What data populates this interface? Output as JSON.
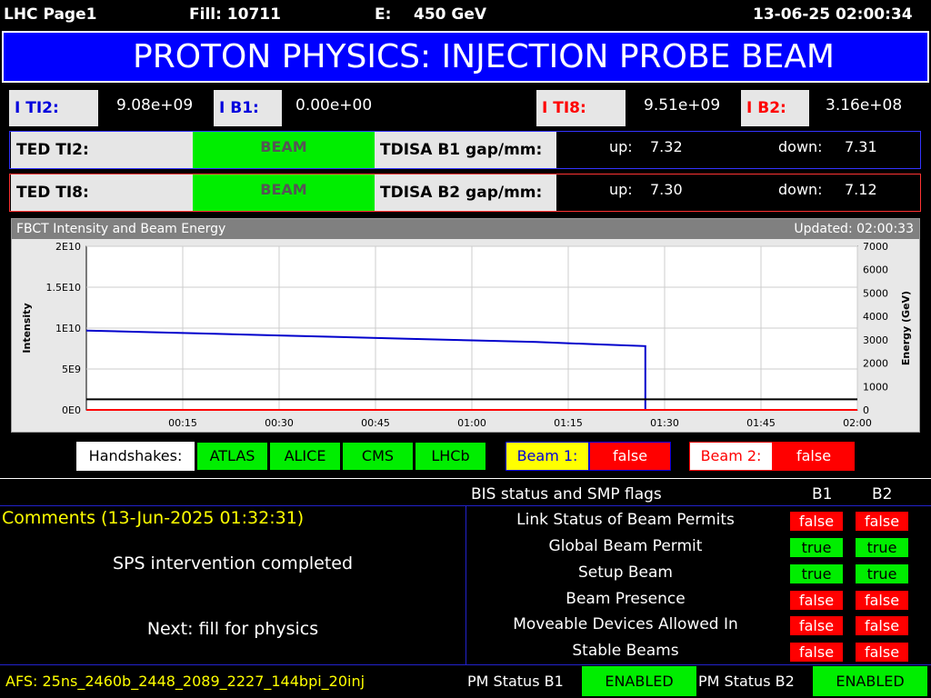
{
  "header": {
    "page": "LHC Page1",
    "fill": "Fill: 10711",
    "energy_label": "E:",
    "energy": "450 GeV",
    "datetime": "13-06-25 02:00:34"
  },
  "banner": {
    "title": "PROTON PHYSICS: INJECTION PROBE BEAM"
  },
  "intensities": {
    "i_ti2": {
      "label": "I TI2:",
      "value": "9.08e+09"
    },
    "i_b1": {
      "label": "I B1:",
      "value": "0.00e+00"
    },
    "i_ti8": {
      "label": "I TI8:",
      "value": "9.51e+09"
    },
    "i_b2": {
      "label": "I B2:",
      "value": "3.16e+08"
    }
  },
  "ted": {
    "ti2": {
      "label": "TED TI2:",
      "state": "BEAM"
    },
    "ti8": {
      "label": "TED TI8:",
      "state": "BEAM"
    }
  },
  "tdisa": {
    "b1": {
      "label": "TDISA B1 gap/mm:",
      "up_label": "up:",
      "up": "7.32",
      "down_label": "down:",
      "down": "7.31"
    },
    "b2": {
      "label": "TDISA B2 gap/mm:",
      "up_label": "up:",
      "up": "7.30",
      "down_label": "down:",
      "down": "7.12"
    }
  },
  "chart": {
    "title": "FBCT Intensity and Beam Energy",
    "updated": "Updated: 02:00:33",
    "ylabel_left": "Intensity",
    "ylabel_right": "Energy (GeV)",
    "left_ticks": [
      "2E10",
      "1.5E10",
      "1E10",
      "5E9",
      "0E0"
    ],
    "right_ticks": [
      "7000",
      "6000",
      "5000",
      "4000",
      "3000",
      "2000",
      "1000",
      "0"
    ],
    "x_ticks": [
      "00:15",
      "00:30",
      "00:45",
      "01:00",
      "01:15",
      "01:30",
      "01:45",
      "02:00"
    ]
  },
  "chart_data": {
    "type": "line",
    "title": "FBCT Intensity and Beam Energy",
    "xlabel": "",
    "ylabel": "Intensity",
    "y2label": "Energy (GeV)",
    "xlim": [
      "00:00",
      "02:00"
    ],
    "ylim": [
      0,
      20000000000
    ],
    "y2lim": [
      0,
      7000
    ],
    "series": [
      {
        "axis": "left",
        "color": "#0000cc",
        "x": [
          "00:00",
          "00:10",
          "00:20",
          "00:30",
          "00:40",
          "00:50",
          "01:00",
          "01:10",
          "01:20",
          "01:27",
          "01:27"
        ],
        "values": [
          9700000000.0,
          9500000000.0,
          9300000000.0,
          9100000000.0,
          8900000000.0,
          8700000000.0,
          8500000000.0,
          8300000000.0,
          8000000000.0,
          7800000000.0,
          0
        ]
      },
      {
        "axis": "right",
        "color": "#000000",
        "x": [
          "00:00",
          "02:00"
        ],
        "values": [
          450,
          450
        ]
      },
      {
        "axis": "left",
        "color": "#ff0000",
        "x": [
          "00:00",
          "02:00"
        ],
        "values": [
          0,
          0
        ]
      }
    ]
  },
  "handshakes": {
    "label": "Handshakes:",
    "items": [
      "ATLAS",
      "ALICE",
      "CMS",
      "LHCb"
    ]
  },
  "beam_flags": {
    "beam1": {
      "label": "Beam 1:",
      "value": "false"
    },
    "beam2": {
      "label": "Beam 2:",
      "value": "false"
    }
  },
  "bis": {
    "title": "BIS status and SMP flags",
    "col_b1": "B1",
    "col_b2": "B2",
    "rows": [
      {
        "label": "Link Status of Beam Permits",
        "b1": "false",
        "b2": "false"
      },
      {
        "label": "Global Beam Permit",
        "b1": "true",
        "b2": "true"
      },
      {
        "label": "Setup Beam",
        "b1": "true",
        "b2": "true"
      },
      {
        "label": "Beam Presence",
        "b1": "false",
        "b2": "false"
      },
      {
        "label": "Moveable Devices Allowed In",
        "b1": "false",
        "b2": "false"
      },
      {
        "label": "Stable Beams",
        "b1": "false",
        "b2": "false"
      }
    ]
  },
  "comments": {
    "title": "Comments (13-Jun-2025 01:32:31)",
    "line1": "SPS intervention completed",
    "line2": "Next: fill for physics"
  },
  "footer": {
    "afs": "AFS: 25ns_2460b_2448_2089_2227_144bpi_20inj",
    "pm_b1_label": "PM Status B1",
    "pm_b1": "ENABLED",
    "pm_b2_label": "PM Status B2",
    "pm_b2": "ENABLED"
  },
  "colors": {
    "banner": "#0000ff",
    "ok": "#00ee00",
    "bad": "#ff0000",
    "b1": "#0000cc",
    "b2": "#ff0000",
    "comment": "#ffff00"
  }
}
